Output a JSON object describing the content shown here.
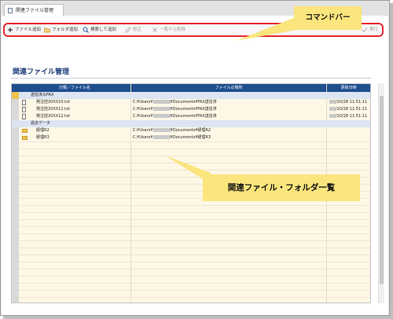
{
  "tab": {
    "title": "関連ファイル管理"
  },
  "callouts": {
    "command_bar": "コマンドバー",
    "list_area": "関連ファイル・フォルダ一覧"
  },
  "toolbar": {
    "add_file": "ファイル追加",
    "add_folder": "フォルダ追加",
    "search_add": "検索して追加",
    "edit": "修正",
    "remove_from_list": "一覧から削除",
    "execute": "実行"
  },
  "page": {
    "title": "関連ファイル管理"
  },
  "table": {
    "columns": {
      "name": "分類／ファイル名",
      "location": "ファイルの場所",
      "updated": "更新日時"
    },
    "groups": [
      {
        "label": "送信済みFAX",
        "rows": [
          {
            "kind": "file",
            "name": "発注控20XX10.txt",
            "path_prefix": "C:¥Users¥",
            "path_suffix": "¥Documents¥FAX送信済",
            "date_suffix": "/10/28 11:51:11"
          },
          {
            "kind": "file",
            "name": "発注控20XX11.txt",
            "path_prefix": "C:¥Users¥",
            "path_suffix": "¥Documents¥FAX送信済",
            "date_suffix": "/10/28 11:51:11"
          },
          {
            "kind": "file",
            "name": "発注控20XX12.txt",
            "path_prefix": "C:¥Users¥",
            "path_suffix": "¥Documents¥FAX送信済",
            "date_suffix": "/10/28 11:51:11"
          }
        ]
      },
      {
        "label": "過去データ",
        "rows": [
          {
            "kind": "folder",
            "name": "経理R2",
            "path_prefix": "C:¥Users¥",
            "path_suffix": "¥Documents¥経理R2",
            "date_suffix": ""
          },
          {
            "kind": "folder",
            "name": "経理R3",
            "path_prefix": "C:¥Users¥",
            "path_suffix": "¥Documents¥経理R3",
            "date_suffix": ""
          }
        ]
      }
    ]
  },
  "colors": {
    "accent": "#1f4e8f",
    "highlight": "#e8282f",
    "callout": "#fbe57d",
    "grid_bg": "#fdf7e6"
  }
}
